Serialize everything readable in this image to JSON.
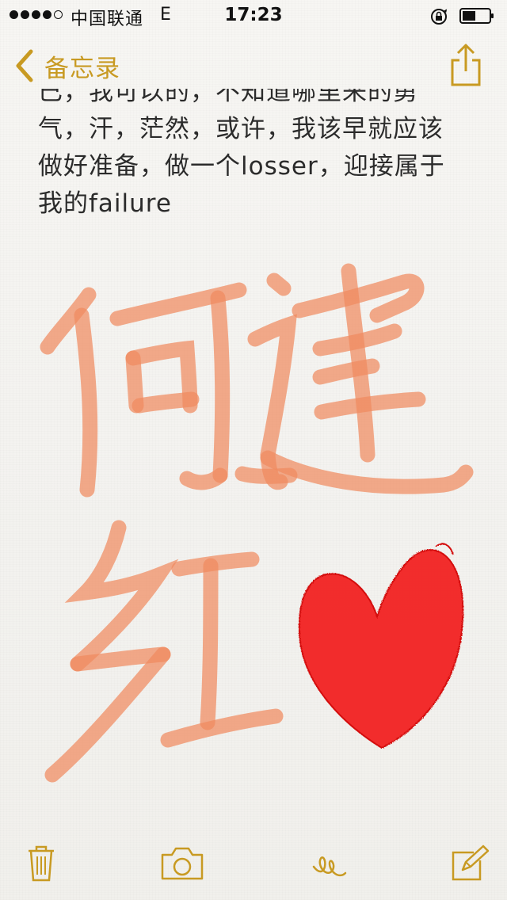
{
  "status_bar": {
    "carrier": "中国联通",
    "network": "E",
    "time": "17:23"
  },
  "nav": {
    "back_label": "备忘录"
  },
  "note": {
    "lines": [
      "已，我可以的，不知道哪里来的勇",
      "气，汗，茫然，或许，我该早就应该",
      "做好准备，做一个losser，迎接属于",
      "我的failure"
    ]
  },
  "sketch": {
    "handwriting": "何建红",
    "ink_color": "#f08a60",
    "heart_color": "#f21d1d",
    "heart_icon": "heart-drawing"
  },
  "toolbar": {
    "icons": [
      "trash-icon",
      "camera-icon",
      "squiggle-sketch-icon",
      "compose-icon"
    ]
  },
  "colors": {
    "accent": "#c89a22",
    "text": "#2b2b2b"
  }
}
